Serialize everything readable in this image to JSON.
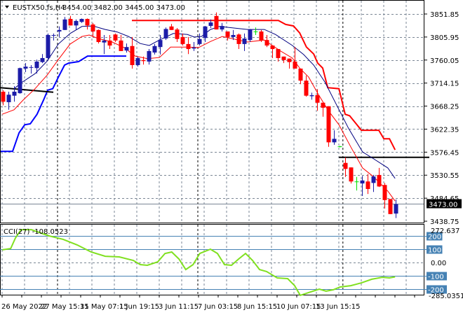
{
  "header": {
    "symbol": "EUSTX50.fs,H4",
    "ohlc": "3454.00 3482.00 3445.00 3473.00"
  },
  "price_axis": {
    "labels": [
      "3851.85",
      "3805.95",
      "3760.05",
      "3714.15",
      "3668.25",
      "3622.35",
      "3576.45",
      "3530.55",
      "3484.65",
      "3438.75"
    ],
    "current_price": "3473.00"
  },
  "cci": {
    "title": "CCI(27) -108.0523",
    "max_label": "272.637",
    "min_label": "-285.0351",
    "zero_label": "0.00",
    "levels": [
      "200",
      "100",
      "-100",
      "-200"
    ],
    "line": [
      [
        -0.1,
        95
      ],
      [
        1.4,
        105
      ],
      [
        2.25,
        184
      ],
      [
        3.25,
        247
      ],
      [
        5.1,
        247
      ],
      [
        5.75,
        237
      ],
      [
        8.25,
        200
      ],
      [
        10.75,
        174
      ],
      [
        13.25,
        132
      ],
      [
        15.75,
        79
      ],
      [
        18.25,
        47
      ],
      [
        20.75,
        42
      ],
      [
        23.25,
        16
      ],
      [
        24.5,
        -16
      ],
      [
        25.75,
        -21
      ],
      [
        27.6,
        5
      ],
      [
        28.9,
        68
      ],
      [
        30.1,
        79
      ],
      [
        31.4,
        26
      ],
      [
        32.6,
        -53
      ],
      [
        33.9,
        -16
      ],
      [
        35.1,
        68
      ],
      [
        37,
        100
      ],
      [
        38.25,
        68
      ],
      [
        39.5,
        -16
      ],
      [
        40.75,
        -21
      ],
      [
        42,
        26
      ],
      [
        43.25,
        68
      ],
      [
        44.5,
        16
      ],
      [
        45.75,
        -53
      ],
      [
        47,
        -68
      ],
      [
        48.9,
        -116
      ],
      [
        50.75,
        -121
      ],
      [
        52,
        -174
      ],
      [
        53,
        -247
      ],
      [
        54.5,
        -226
      ],
      [
        56.4,
        -200
      ],
      [
        57.6,
        -216
      ],
      [
        58.9,
        -205
      ],
      [
        60.1,
        -184
      ],
      [
        62,
        -174
      ],
      [
        63.9,
        -153
      ],
      [
        65.75,
        -126
      ],
      [
        67.6,
        -111
      ],
      [
        68.9,
        -116
      ],
      [
        69.9,
        -108
      ]
    ]
  },
  "time_axis": {
    "labels": [
      "26 May 2022",
      "27 May 15:15",
      "31 May 07:15",
      "1 Jun 19:15",
      "3 Jun 11:15",
      "7 Jun 03:15",
      "8 Jun 15:15",
      "10 Jun 07:15",
      "13 Jun 15:15"
    ]
  },
  "colors": {
    "up": "#1c1ca8",
    "down": "#ff0000",
    "doji": "#00e000",
    "cci": "#80e020",
    "level": "#4682b4",
    "grid": "#7a8694"
  },
  "candles": [
    [
      3697,
      3700,
      3670,
      3677
    ],
    [
      3676,
      3697,
      3661,
      3691
    ],
    [
      3689,
      3708,
      3677,
      3697
    ],
    [
      3694,
      3745,
      3693,
      3744
    ],
    [
      3743,
      3754,
      3736,
      3747
    ],
    [
      3745,
      3750,
      3733,
      3746
    ],
    [
      3744,
      3761,
      3733,
      3757
    ],
    [
      3756,
      3772,
      3754,
      3764
    ],
    [
      3764,
      3813,
      3761,
      3810
    ],
    [
      3809,
      3813,
      3799,
      3810
    ],
    [
      3817,
      3827,
      3806,
      3820
    ],
    [
      3820,
      3846,
      3820,
      3841
    ],
    [
      3842,
      3848,
      3829,
      3829
    ],
    [
      3829,
      3841,
      3820,
      3838
    ],
    [
      3836,
      3843,
      3834,
      3842
    ],
    [
      3842,
      3843,
      3821,
      3829
    ],
    [
      3831,
      3834,
      3806,
      3817
    ],
    [
      3820,
      3821,
      3793,
      3796
    ],
    [
      3795,
      3810,
      3772,
      3799
    ],
    [
      3799,
      3810,
      3782,
      3789
    ],
    [
      3811,
      3813,
      3796,
      3799
    ],
    [
      3799,
      3810,
      3778,
      3778
    ],
    [
      3779,
      3793,
      3775,
      3786
    ],
    [
      3788,
      3806,
      3743,
      3750
    ],
    [
      3750,
      3767,
      3747,
      3764
    ],
    [
      3760,
      3767,
      3751,
      3758
    ],
    [
      3757,
      3782,
      3751,
      3778
    ],
    [
      3775,
      3792,
      3771,
      3788
    ],
    [
      3786,
      3810,
      3771,
      3800
    ],
    [
      3803,
      3825,
      3800,
      3822
    ],
    [
      3827,
      3832,
      3820,
      3820
    ],
    [
      3821,
      3824,
      3796,
      3802
    ],
    [
      3806,
      3813,
      3789,
      3792
    ],
    [
      3792,
      3806,
      3772,
      3782
    ],
    [
      3783,
      3796,
      3778,
      3785
    ],
    [
      3792,
      3813,
      3789,
      3802
    ],
    [
      3804,
      3828,
      3796,
      3827
    ],
    [
      3828,
      3841,
      3824,
      3835
    ],
    [
      3848,
      3855,
      3821,
      3821
    ],
    [
      3821,
      3834,
      3817,
      3828
    ],
    [
      3817,
      3817,
      3799,
      3806
    ],
    [
      3806,
      3820,
      3800,
      3810
    ],
    [
      3811,
      3813,
      3782,
      3792
    ],
    [
      3792,
      3813,
      3778,
      3803
    ],
    [
      3800,
      3822,
      3796,
      3821
    ],
    [
      3817,
      3825,
      3810,
      3817
    ],
    [
      3817,
      3820,
      3796,
      3799
    ],
    [
      3800,
      3810,
      3786,
      3789
    ],
    [
      3789,
      3789,
      3764,
      3782
    ],
    [
      3782,
      3782,
      3757,
      3764
    ],
    [
      3767,
      3767,
      3754,
      3760
    ],
    [
      3763,
      3763,
      3743,
      3756
    ],
    [
      3757,
      3786,
      3743,
      3743
    ],
    [
      3743,
      3743,
      3712,
      3719
    ],
    [
      3719,
      3729,
      3687,
      3689
    ],
    [
      3688,
      3695,
      3681,
      3690
    ],
    [
      3690,
      3702,
      3659,
      3675
    ],
    [
      3675,
      3675,
      3647,
      3665
    ],
    [
      3668,
      3668,
      3587,
      3596
    ],
    [
      3596,
      3620,
      3591,
      3603
    ],
    [
      3588,
      3589,
      3586,
      3588
    ],
    [
      3555,
      3566,
      3527,
      3543
    ],
    [
      3546,
      3546,
      3514,
      3518
    ],
    [
      3518,
      3527,
      3500,
      3518
    ],
    [
      3514,
      3529,
      3489,
      3520
    ],
    [
      3518,
      3533,
      3493,
      3503
    ],
    [
      3515,
      3531,
      3497,
      3528
    ],
    [
      3531,
      3545,
      3507,
      3508
    ],
    [
      3511,
      3515,
      3464,
      3481
    ],
    [
      3483,
      3483,
      3453,
      3453
    ],
    [
      3454,
      3482,
      3445,
      3473
    ]
  ],
  "lines": {
    "envelope_upper": [
      [
        23,
        3839
      ],
      [
        49.1,
        3839
      ],
      [
        50.4,
        3831
      ],
      [
        51.8,
        3828
      ],
      [
        52.9,
        3814
      ],
      [
        54.1,
        3786
      ],
      [
        55.4,
        3772
      ],
      [
        56.1,
        3754
      ],
      [
        57,
        3744
      ],
      [
        57.9,
        3705
      ],
      [
        59.9,
        3703
      ],
      [
        61,
        3652
      ],
      [
        61.8,
        3649
      ],
      [
        63.9,
        3620
      ],
      [
        67,
        3620
      ],
      [
        67.9,
        3603
      ],
      [
        68.9,
        3603
      ],
      [
        69.9,
        3581
      ]
    ],
    "envelope_lower": [
      [
        -0.5,
        3578
      ],
      [
        1.75,
        3578
      ],
      [
        2.9,
        3615
      ],
      [
        3.9,
        3631
      ],
      [
        4.9,
        3633
      ],
      [
        6.1,
        3652
      ],
      [
        7.25,
        3680
      ],
      [
        8,
        3700
      ],
      [
        8.9,
        3703
      ],
      [
        9.9,
        3726
      ],
      [
        11,
        3750
      ],
      [
        11.75,
        3754
      ],
      [
        13.5,
        3757
      ],
      [
        15.1,
        3768
      ],
      [
        22,
        3768
      ]
    ],
    "level_left": [
      [
        -0.5,
        3705
      ],
      [
        9,
        3696
      ]
    ],
    "level_right": [
      [
        59.9,
        3566
      ],
      [
        76,
        3566
      ]
    ],
    "ma_slow": [
      [
        2,
        3703
      ],
      [
        3.6,
        3717
      ],
      [
        5.75,
        3733
      ],
      [
        7.9,
        3758
      ],
      [
        9.9,
        3792
      ],
      [
        12,
        3813
      ],
      [
        14.1,
        3827
      ],
      [
        16.1,
        3828
      ],
      [
        18.25,
        3821
      ],
      [
        20.4,
        3816
      ],
      [
        22.4,
        3807
      ],
      [
        24.5,
        3793
      ],
      [
        26.1,
        3789
      ],
      [
        27.9,
        3800
      ],
      [
        30.4,
        3813
      ],
      [
        32.9,
        3811
      ],
      [
        34.1,
        3806
      ],
      [
        35.4,
        3807
      ],
      [
        37,
        3821
      ],
      [
        38.6,
        3827
      ],
      [
        43.6,
        3821
      ],
      [
        46.6,
        3821
      ],
      [
        48.6,
        3811
      ],
      [
        51.6,
        3789
      ],
      [
        53.6,
        3771
      ],
      [
        55.4,
        3750
      ],
      [
        57.4,
        3716
      ],
      [
        59.5,
        3670
      ],
      [
        61.6,
        3624
      ],
      [
        64.1,
        3577
      ],
      [
        66.1,
        3563
      ],
      [
        68.6,
        3545
      ],
      [
        69.9,
        3524
      ]
    ],
    "ma_fast": [
      [
        -0.1,
        3652
      ],
      [
        2,
        3661
      ],
      [
        3.6,
        3680
      ],
      [
        5.75,
        3703
      ],
      [
        7.9,
        3730
      ],
      [
        9.9,
        3761
      ],
      [
        12,
        3792
      ],
      [
        14.1,
        3807
      ],
      [
        15.4,
        3810
      ],
      [
        17,
        3803
      ],
      [
        19.5,
        3796
      ],
      [
        21.6,
        3785
      ],
      [
        23.6,
        3768
      ],
      [
        25.75,
        3763
      ],
      [
        27.9,
        3765
      ],
      [
        29.9,
        3786
      ],
      [
        32.9,
        3786
      ],
      [
        34.9,
        3785
      ],
      [
        37,
        3797
      ],
      [
        39.1,
        3807
      ],
      [
        43.6,
        3796
      ],
      [
        46.6,
        3800
      ],
      [
        49.5,
        3778
      ],
      [
        51.6,
        3764
      ],
      [
        52.9,
        3744
      ],
      [
        54.5,
        3726
      ],
      [
        56.1,
        3694
      ],
      [
        57.9,
        3661
      ],
      [
        59.9,
        3631
      ],
      [
        62,
        3587
      ],
      [
        64.1,
        3545
      ],
      [
        66.1,
        3527
      ],
      [
        68.6,
        3499
      ],
      [
        69.9,
        3479
      ]
    ]
  }
}
